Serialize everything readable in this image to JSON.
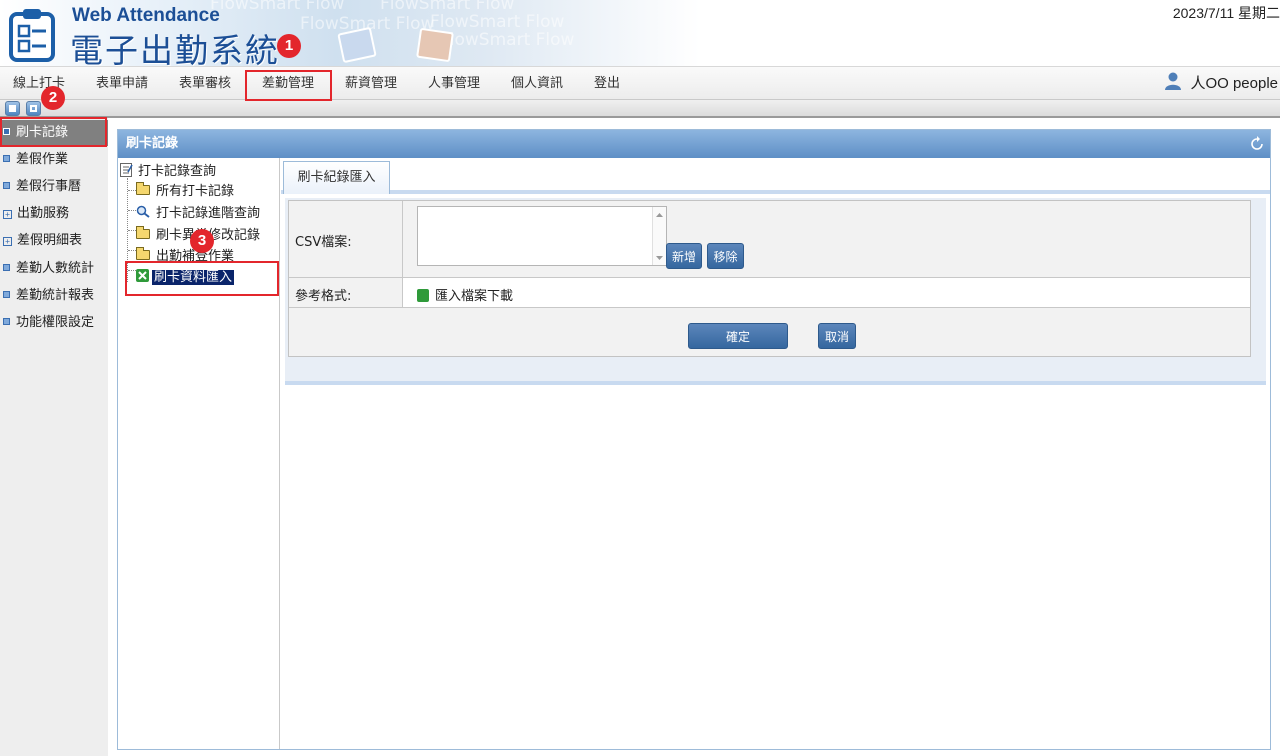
{
  "app": {
    "title_en": "Web Attendance",
    "title_zh": "電子出勤系統",
    "watermark": "FlowSmart Flow",
    "date": "2023/7/11 星期二"
  },
  "menu": {
    "items": [
      "線上打卡",
      "表單申請",
      "表單審核",
      "差勤管理",
      "薪資管理",
      "人事管理",
      "個人資訊",
      "登出"
    ],
    "active": "差勤管理",
    "user": "人OO people"
  },
  "sidebar": {
    "items": [
      "刷卡記錄",
      "差假作業",
      "差假行事曆",
      "出勤服務",
      "差假明細表",
      "差勤人數統計",
      "差勤統計報表",
      "功能權限設定"
    ],
    "active": "刷卡記錄"
  },
  "panel": {
    "title": "刷卡記錄"
  },
  "tree": {
    "root": "打卡記錄查詢",
    "children": [
      "所有打卡記錄",
      "打卡記錄進階查詢",
      "刷卡異常修改記錄",
      "出勤補登作業",
      "刷卡資料匯入"
    ],
    "selected": "刷卡資料匯入"
  },
  "tab": {
    "label": "刷卡紀錄匯入"
  },
  "form": {
    "csv_label": "CSV檔案:",
    "add_button": "新增",
    "remove_button": "移除",
    "format_label": "參考格式:",
    "format_link": "匯入檔案下載",
    "confirm_button": "確定",
    "cancel_button": "取消"
  },
  "annotations": {
    "badge1": "1",
    "badge2": "2",
    "badge3": "3",
    "marker_color": "#e3262c"
  }
}
